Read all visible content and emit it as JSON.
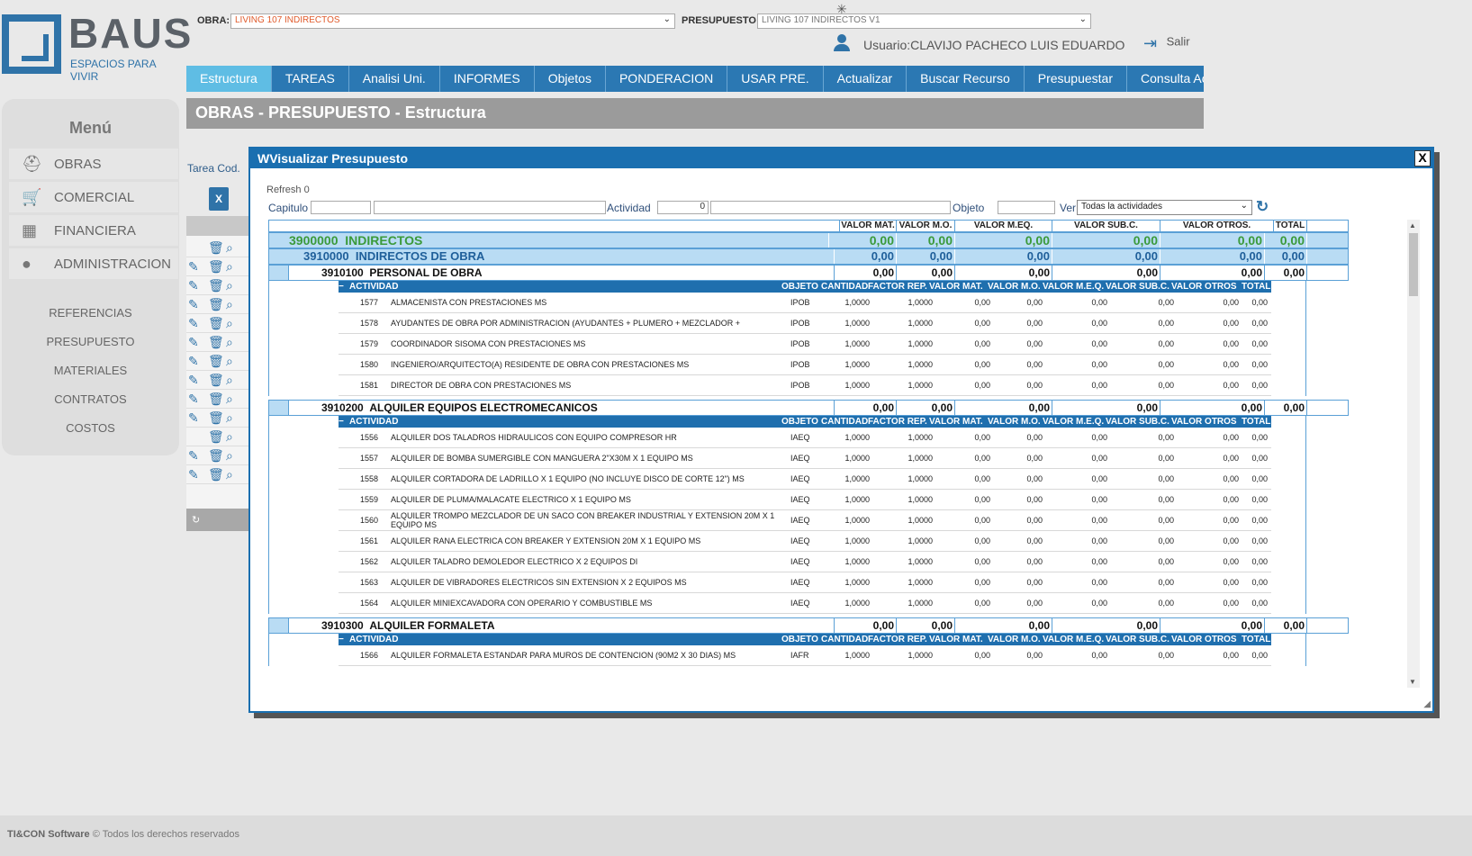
{
  "brand": {
    "name": "BAUS",
    "tagline": "ESPACIOS PARA VIVIR"
  },
  "header": {
    "obra_label": "OBRA:",
    "obra_value": "LIVING 107 INDIRECTOS",
    "presupuesto_label": "PRESUPUESTO",
    "presupuesto_value": "LIVING 107 INDIRECTOS V1",
    "user": "Usuario:CLAVIJO PACHECO LUIS EDUARDO",
    "logout": "Salir"
  },
  "nav": [
    "Estructura",
    "TAREAS",
    "Analisi Uni.",
    "INFORMES",
    "Objetos",
    "PONDERACION",
    "USAR PRE.",
    "Actualizar",
    "Buscar Recurso",
    "Presupuestar",
    "Consulta Activ"
  ],
  "page_title": "OBRAS - PRESUPUESTO - Estructura",
  "sidebar": {
    "title": "Menú",
    "items": [
      "OBRAS",
      "COMERCIAL",
      "FINANCIERA",
      "ADMINISTRACION"
    ],
    "links": [
      "REFERENCIAS",
      "PRESUPUESTO",
      "MATERIALES",
      "CONTRATOS",
      "COSTOS"
    ]
  },
  "tarea_label": "Tarea Cod.",
  "footer": {
    "brand": "TI&CON Software",
    "text": "© Todos los derechos reservados"
  },
  "dialog": {
    "title": "WVisualizar Presupuesto",
    "close": "X",
    "refresh": "Refresh 0",
    "capitulo_label": "Capitulo",
    "actividad_label": "Actividad",
    "actividad_value": "0",
    "objeto_label": "Objeto",
    "ver_label": "Ver",
    "ver_value": "Todas la actividades",
    "headers": [
      "VALOR MAT.",
      "VALOR M.O.",
      "VALOR M.EQ.",
      "VALOR SUB.C.",
      "VALOR OTROS.",
      "TOTAL"
    ],
    "act_headers": [
      "ACTIVIDAD",
      "OBJETO",
      "CANTIDAD",
      "FACTOR REP.",
      "VALOR MAT.",
      "VALOR M.O.",
      "VALOR M.E.Q.",
      "VALOR SUB.C.",
      "VALOR OTROS",
      "TOTAL"
    ],
    "level1": {
      "code": "3900000",
      "name": "INDIRECTOS",
      "values": [
        "0,00",
        "0,00",
        "0,00",
        "0,00",
        "0,00",
        "0,00"
      ]
    },
    "level2": {
      "code": "3910000",
      "name": "INDIRECTOS DE OBRA",
      "values": [
        "0,00",
        "0,00",
        "0,00",
        "0,00",
        "0,00",
        "0,00"
      ]
    },
    "sections": [
      {
        "code": "3910100",
        "name": "PERSONAL DE OBRA",
        "values": [
          "0,00",
          "0,00",
          "0,00",
          "0,00",
          "0,00",
          "0,00"
        ],
        "rows": [
          [
            "1577",
            "ALMACENISTA CON PRESTACIONES MS",
            "IPOB"
          ],
          [
            "1578",
            "AYUDANTES DE OBRA POR ADMINISTRACION (AYUDANTES + PLUMERO + MEZCLADOR + CORTADOR) MS",
            "IPOB"
          ],
          [
            "1579",
            "COORDINADOR SISOMA CON PRESTACIONES MS",
            "IPOB"
          ],
          [
            "1580",
            "INGENIERO/ARQUITECTO(A) RESIDENTE DE OBRA CON PRESTACIONES MS",
            "IPOB"
          ],
          [
            "1581",
            "DIRECTOR DE OBRA CON PRESTACIONES MS",
            "IPOB"
          ]
        ]
      },
      {
        "code": "3910200",
        "name": "ALQUILER EQUIPOS ELECTROMECANICOS",
        "values": [
          "0,00",
          "0,00",
          "0,00",
          "0,00",
          "0,00",
          "0,00"
        ],
        "rows": [
          [
            "1556",
            "ALQUILER DOS TALADROS HIDRAULICOS CON EQUIPO COMPRESOR HR",
            "IAEQ"
          ],
          [
            "1557",
            "ALQUILER DE BOMBA SUMERGIBLE CON MANGUERA 2\"X30M X 1 EQUIPO MS",
            "IAEQ"
          ],
          [
            "1558",
            "ALQUILER CORTADORA DE LADRILLO X 1 EQUIPO (NO INCLUYE DISCO DE CORTE 12\") MS",
            "IAEQ"
          ],
          [
            "1559",
            "ALQUILER DE PLUMA/MALACATE ELECTRICO X 1 EQUIPO MS",
            "IAEQ"
          ],
          [
            "1560",
            "ALQUILER TROMPO MEZCLADOR DE UN SACO CON BREAKER INDUSTRIAL Y EXTENSION 20M X 1 EQUIPO MS",
            "IAEQ"
          ],
          [
            "1561",
            "ALQUILER RANA ELECTRICA CON BREAKER Y EXTENSION 20M X 1 EQUIPO MS",
            "IAEQ"
          ],
          [
            "1562",
            "ALQUILER TALADRO DEMOLEDOR ELECTRICO X 2 EQUIPOS DI",
            "IAEQ"
          ],
          [
            "1563",
            "ALQUILER DE VIBRADORES ELECTRICOS SIN EXTENSION X 2 EQUIPOS MS",
            "IAEQ"
          ],
          [
            "1564",
            "ALQUILER MINIEXCAVADORA CON OPERARIO Y COMBUSTIBLE MS",
            "IAEQ"
          ]
        ]
      },
      {
        "code": "3910300",
        "name": "ALQUILER FORMALETA",
        "values": [
          "0,00",
          "0,00",
          "0,00",
          "0,00",
          "0,00",
          "0,00"
        ],
        "rows": [
          [
            "1566",
            "ALQUILER FORMALETA ESTANDAR PARA MUROS DE CONTENCION (90M2 X 30 DIAS) MS",
            "IAFR"
          ]
        ]
      }
    ],
    "row_values": [
      "1,0000",
      "1,0000",
      "0,00",
      "0,00",
      "0,00",
      "0,00",
      "0,00",
      "0,00"
    ]
  }
}
